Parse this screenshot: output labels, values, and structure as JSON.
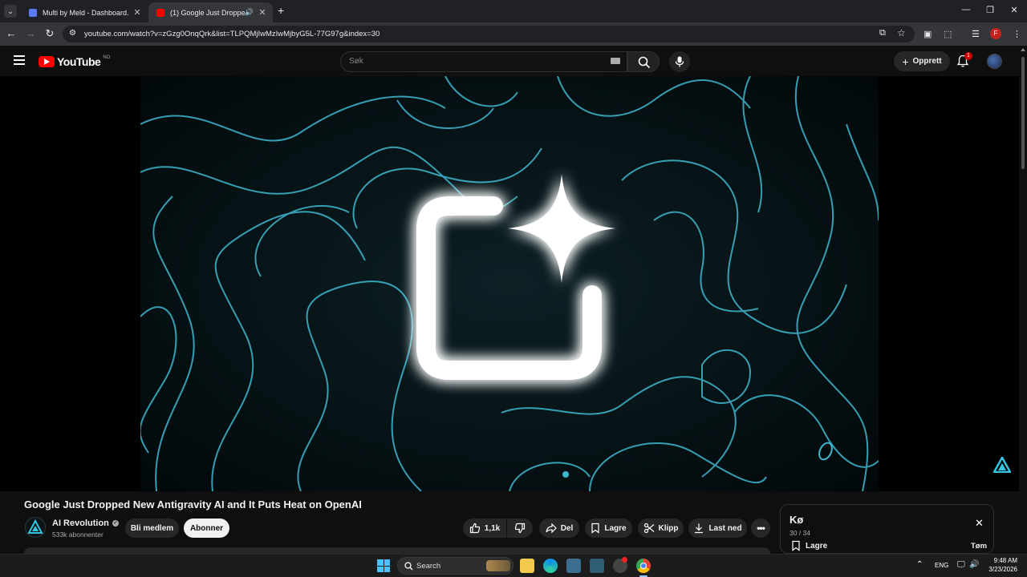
{
  "browser": {
    "tabs": [
      {
        "title": "Multi by Meld - Dashboard.",
        "active": false
      },
      {
        "title": "(1) Google Just Dropped Ne",
        "active": true
      }
    ],
    "url": "youtube.com/watch?v=zGzg0OnqQrk&list=TLPQMjIwMzIwMjbyG5L-77G97g&index=30",
    "profile_initial": "F"
  },
  "youtube": {
    "logo_text": "YouTube",
    "country_code": "NO",
    "search_placeholder": "Søk",
    "create_label": "Opprett",
    "notification_count": "1"
  },
  "video": {
    "title": "Google Just Dropped New Antigravity AI and It Puts Heat on OpenAI",
    "channel_name": "AI Revolution",
    "subscribers": "533k abonnenter",
    "join_label": "Bli medlem",
    "subscribe_label": "Abonner",
    "likes": "1,1k",
    "share_label": "Del",
    "save_label": "Lagre",
    "clip_label": "Klipp",
    "download_label": "Last ned"
  },
  "queue": {
    "title": "Kø",
    "position": "30 / 34",
    "save_label": "Lagre",
    "clear_label": "Tøm"
  },
  "taskbar": {
    "search_label": "Search",
    "language": "ENG",
    "time": "9:48 AM",
    "date": "3/23/2026"
  },
  "colors": {
    "youtube_red": "#ff0000",
    "contour_blue": "#3fb8cf",
    "chrome_dark": "#202124"
  }
}
